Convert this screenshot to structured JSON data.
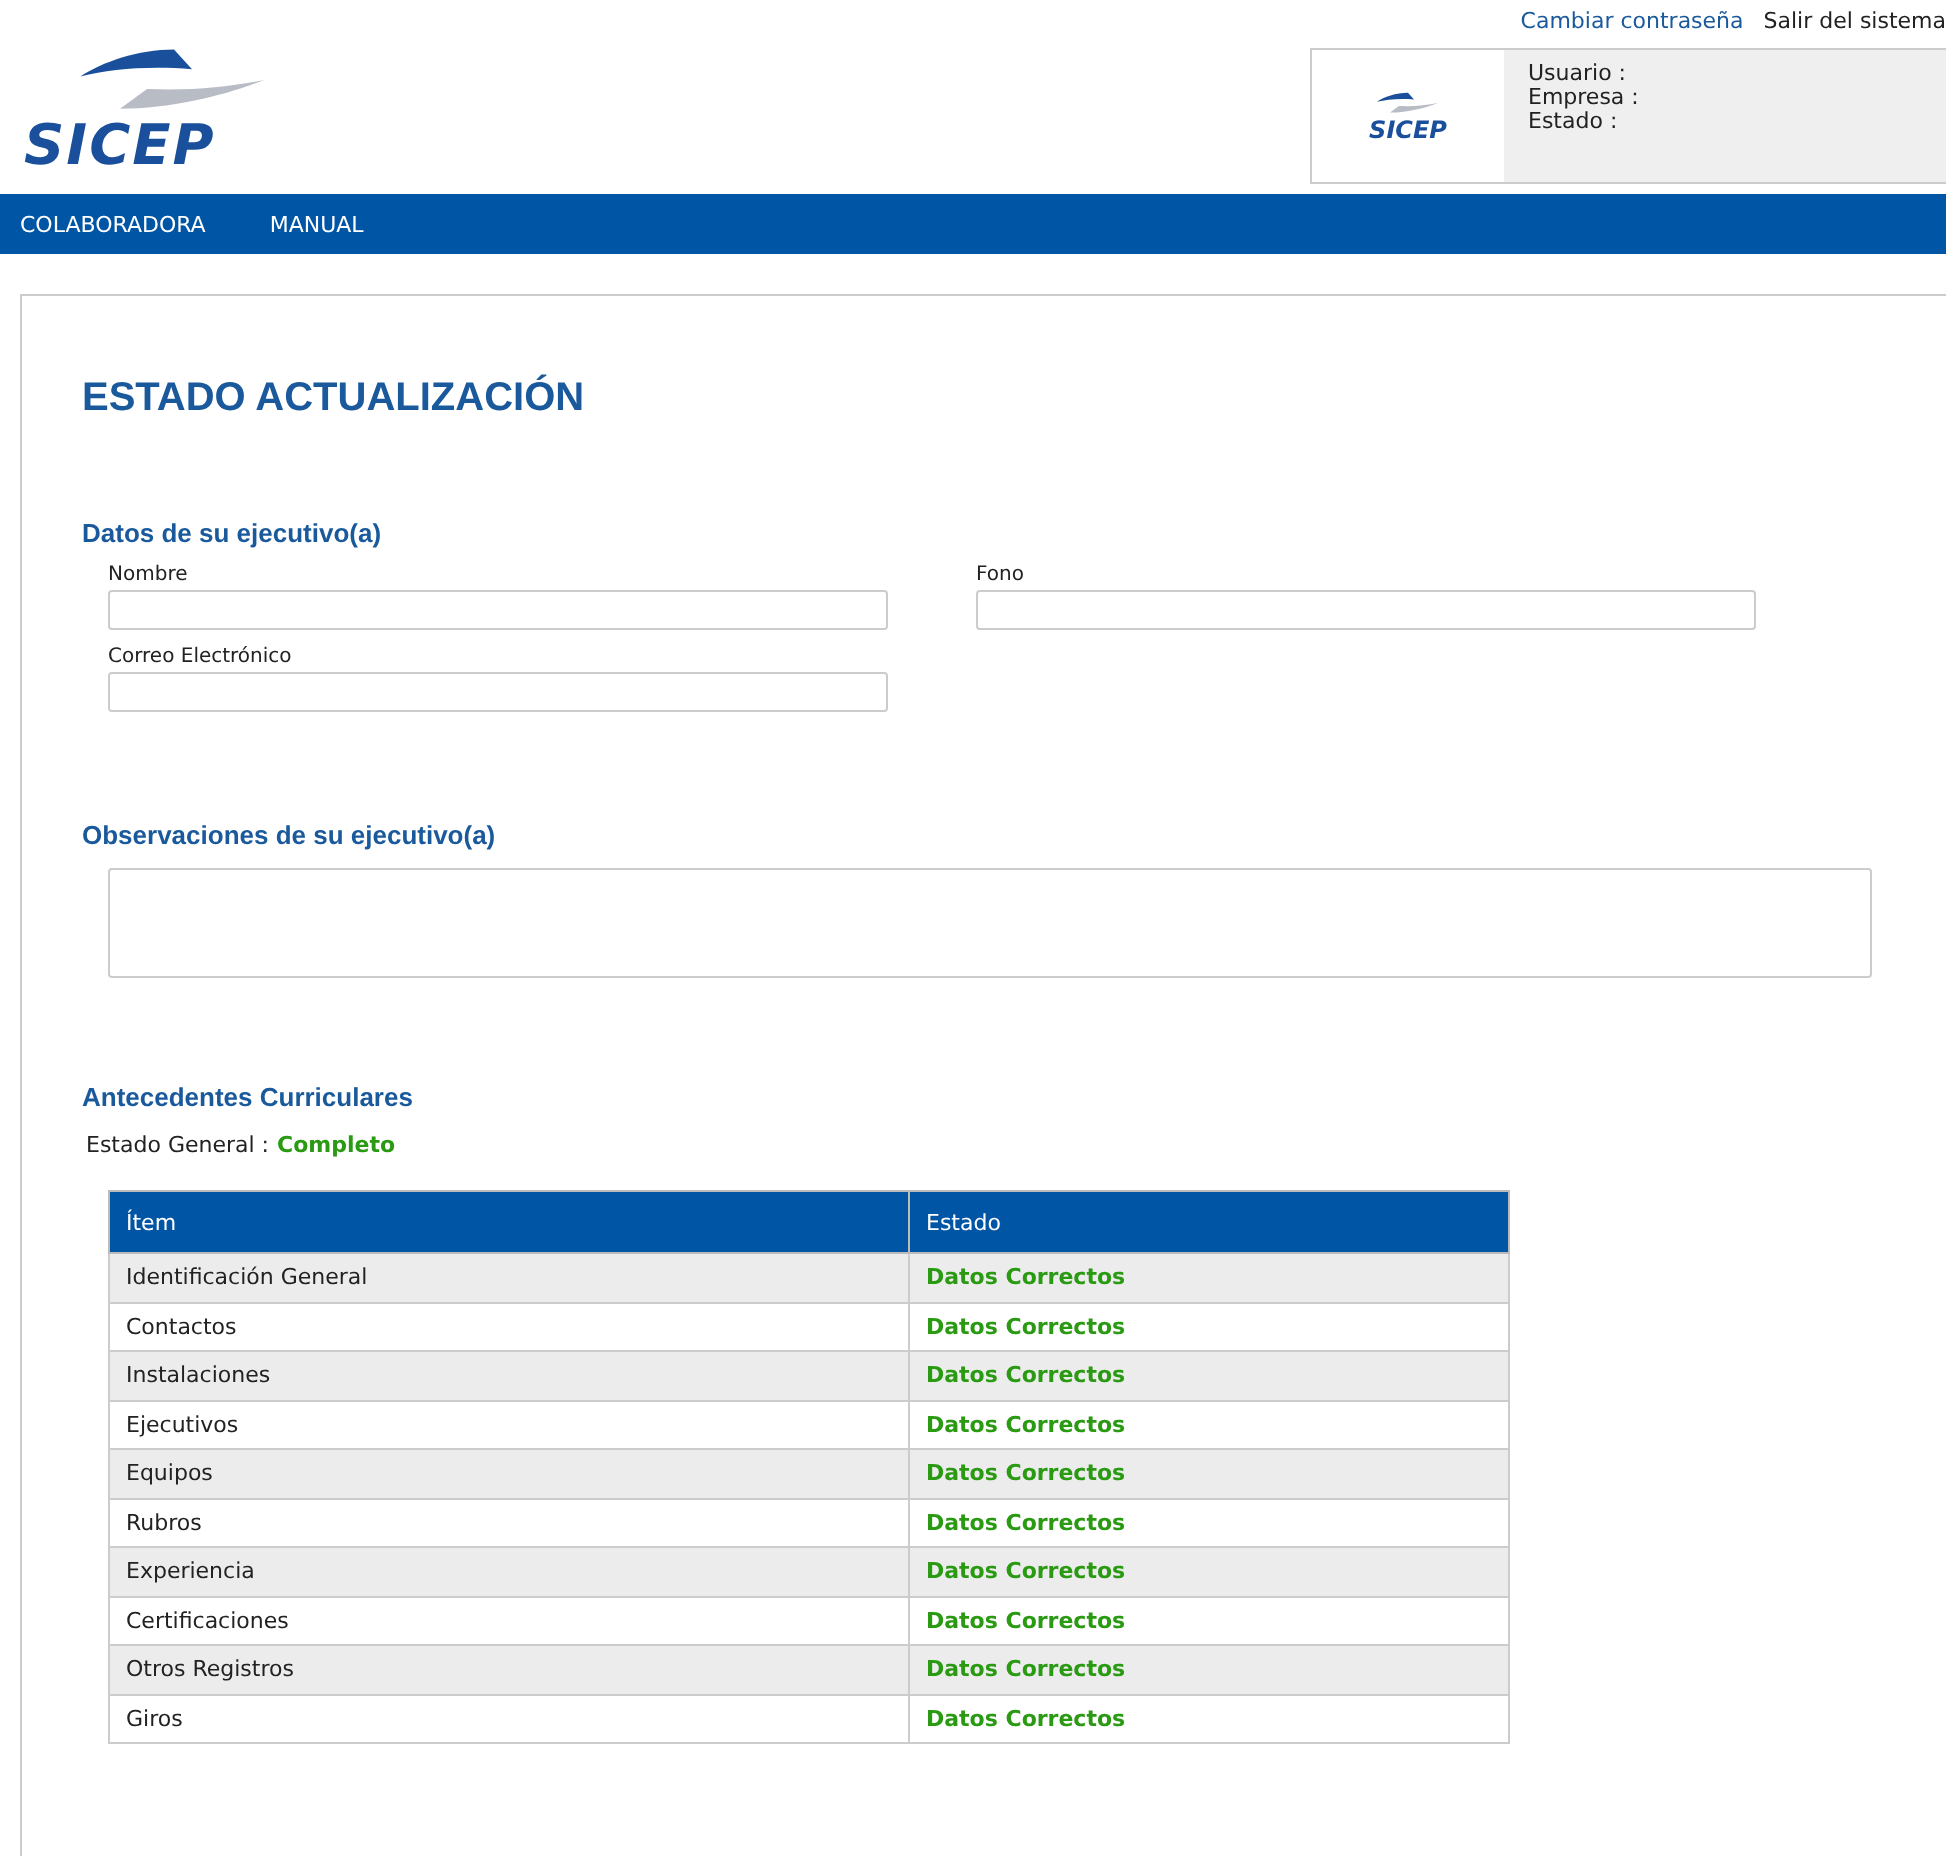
{
  "header": {
    "logo": "SICEP",
    "links": [
      "Cambiar contraseña",
      "Salir del sistema"
    ],
    "user_box": {
      "logo": "SICEP",
      "fields": [
        "Usuario :",
        "Empresa :",
        "Estado :"
      ]
    }
  },
  "nav": [
    "COLABORADORA",
    "MANUAL"
  ],
  "title": "ESTADO ACTUALIZACIÓN",
  "executive": {
    "heading": "Datos de su ejecutivo(a)",
    "fields": [
      {
        "label": "Nombre"
      },
      {
        "label": "Fono"
      },
      {
        "label": "Correo Electrónico"
      }
    ]
  },
  "observations": {
    "heading": "Observaciones de su ejecutivo(a)"
  },
  "curriculum": {
    "heading": "Antecedentes Curriculares",
    "general_label": "Estado General :",
    "general_value": "Completo",
    "table": {
      "columns": [
        "Ítem",
        "Estado"
      ],
      "rows": [
        {
          "item": "Identificación General",
          "status": "Datos Correctos"
        },
        {
          "item": "Contactos",
          "status": "Datos Correctos"
        },
        {
          "item": "Instalaciones",
          "status": "Datos Correctos"
        },
        {
          "item": "Ejecutivos",
          "status": "Datos Correctos"
        },
        {
          "item": "Equipos",
          "status": "Datos Correctos"
        },
        {
          "item": "Rubros",
          "status": "Datos Correctos"
        },
        {
          "item": "Experiencia",
          "status": "Datos Correctos"
        },
        {
          "item": "Certificaciones",
          "status": "Datos Correctos"
        },
        {
          "item": "Otros Registros",
          "status": "Datos Correctos"
        },
        {
          "item": "Giros",
          "status": "Datos Correctos"
        }
      ]
    }
  }
}
